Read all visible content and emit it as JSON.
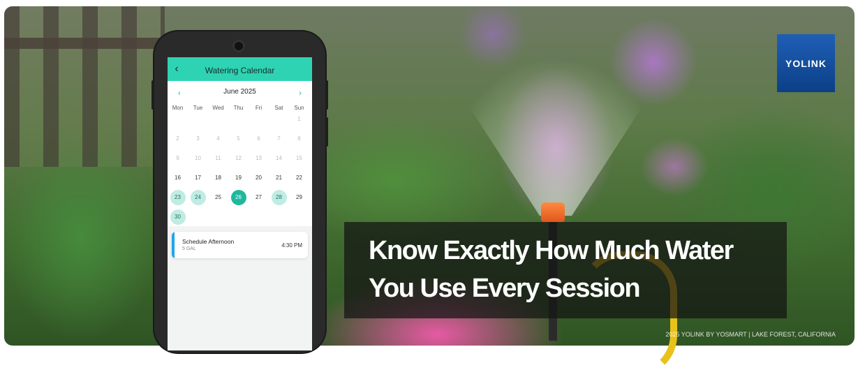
{
  "banner": {
    "headline_line1": "Know Exactly How Much Water",
    "headline_line2": "You Use Every Session",
    "footer": "2025 YOLINK BY YOSMART | LAKE FOREST, CALIFORNIA",
    "logo_text": "YOLINK",
    "colors": {
      "logo_blue": "#1f5fb7",
      "accent_teal": "#2ed3b3"
    }
  },
  "app": {
    "back_icon": "chevron-left-icon",
    "title": "Watering Calendar",
    "calendar": {
      "month_label": "June 2025",
      "prev_icon": "chevron-left-icon",
      "next_icon": "chevron-right-icon",
      "weekdays": [
        "Mon",
        "Tue",
        "Wed",
        "Thu",
        "Fri",
        "Sat",
        "Sun"
      ],
      "weeks": [
        [
          {
            "d": ""
          },
          {
            "d": ""
          },
          {
            "d": ""
          },
          {
            "d": ""
          },
          {
            "d": ""
          },
          {
            "d": ""
          },
          {
            "d": "1",
            "s": "past"
          }
        ],
        [
          {
            "d": "2",
            "s": "past"
          },
          {
            "d": "3",
            "s": "past"
          },
          {
            "d": "4",
            "s": "past"
          },
          {
            "d": "5",
            "s": "past"
          },
          {
            "d": "6",
            "s": "past"
          },
          {
            "d": "7",
            "s": "past"
          },
          {
            "d": "8",
            "s": "past"
          }
        ],
        [
          {
            "d": "9",
            "s": "past"
          },
          {
            "d": "10",
            "s": "past"
          },
          {
            "d": "11",
            "s": "past"
          },
          {
            "d": "12",
            "s": "past"
          },
          {
            "d": "13",
            "s": "past"
          },
          {
            "d": "14",
            "s": "past"
          },
          {
            "d": "15",
            "s": "past"
          }
        ],
        [
          {
            "d": "16",
            "s": "normal"
          },
          {
            "d": "17",
            "s": "normal"
          },
          {
            "d": "18",
            "s": "normal"
          },
          {
            "d": "19",
            "s": "normal"
          },
          {
            "d": "20",
            "s": "normal"
          },
          {
            "d": "21",
            "s": "normal"
          },
          {
            "d": "22",
            "s": "normal"
          }
        ],
        [
          {
            "d": "23",
            "s": "sched"
          },
          {
            "d": "24",
            "s": "sched"
          },
          {
            "d": "25",
            "s": "normal"
          },
          {
            "d": "26",
            "s": "today"
          },
          {
            "d": "27",
            "s": "normal"
          },
          {
            "d": "28",
            "s": "sched"
          },
          {
            "d": "29",
            "s": "normal"
          }
        ],
        [
          {
            "d": "30",
            "s": "sched"
          },
          {
            "d": ""
          },
          {
            "d": ""
          },
          {
            "d": ""
          },
          {
            "d": ""
          },
          {
            "d": ""
          },
          {
            "d": ""
          }
        ]
      ]
    },
    "event": {
      "title": "Schedule Afternoon",
      "amount": "5 GAL",
      "time": "4:30 PM"
    }
  }
}
